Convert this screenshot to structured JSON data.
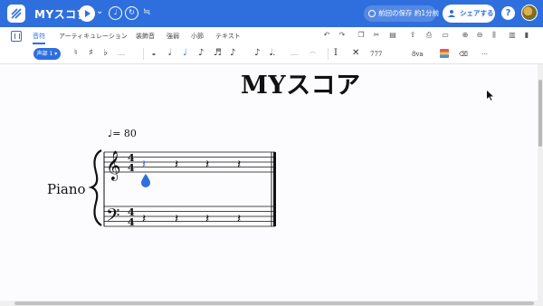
{
  "header": {
    "title": "MYスコア",
    "save_status": "前回の保存 約1分前",
    "share_label": "シェアする",
    "help_label": "?"
  },
  "tabs": [
    {
      "label": "音符",
      "active": true
    },
    {
      "label": "アーティキュレーション",
      "active": false
    },
    {
      "label": "装飾音",
      "active": false
    },
    {
      "label": "強弱",
      "active": false
    },
    {
      "label": "小節",
      "active": false
    },
    {
      "label": "テキスト",
      "active": false
    }
  ],
  "toolbar": {
    "voice_label": "声部 1 ▾",
    "tuplet_label": "777",
    "ottava_label": "8va"
  },
  "score": {
    "title": "MYスコア",
    "tempo": "= 80",
    "instrument": "Piano",
    "time_signature": "4"
  },
  "colors": {
    "brand": "#2f6fdd",
    "selection": "#2f6fdd"
  }
}
